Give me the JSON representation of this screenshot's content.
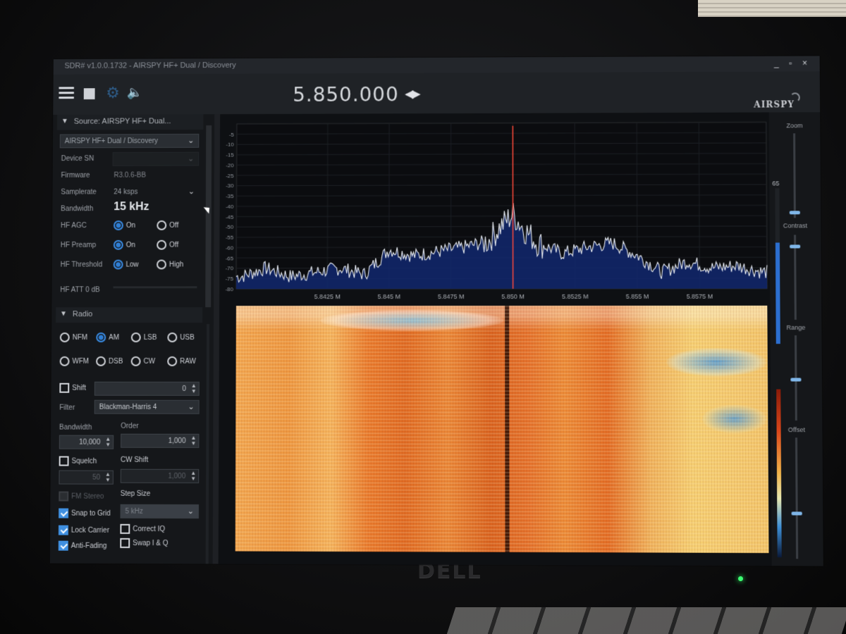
{
  "window": {
    "title": "SDR# v1.0.0.1732 - AIRSPY HF+ Dual / Discovery",
    "controls": [
      "_",
      "▫",
      "×"
    ]
  },
  "toolbar": {
    "frequency": "5.850.000",
    "frequency_arrows": "◀▶",
    "logo": "AIRSPY",
    "icons": [
      "menu-icon",
      "stop-icon",
      "gear-icon",
      "speaker-icon"
    ]
  },
  "source": {
    "header": "Source: AIRSPY HF+ Dual...",
    "device": "AIRSPY HF+ Dual / Discovery",
    "device_sn_label": "Device SN",
    "firmware_label": "Firmware",
    "firmware_value": "R3.0.6-BB",
    "samplerate_label": "Samplerate",
    "samplerate_value": "24 ksps",
    "bandwidth_label": "Bandwidth",
    "bandwidth_value": "15 kHz",
    "hf_agc_label": "HF AGC",
    "hf_preamp_label": "HF Preamp",
    "hf_threshold_label": "HF Threshold",
    "on": "On",
    "off": "Off",
    "low": "Low",
    "high": "High",
    "hf_att": "HF ATT 0 dB"
  },
  "radio": {
    "header": "Radio",
    "modes_row1": [
      "NFM",
      "AM",
      "LSB",
      "USB"
    ],
    "modes_row2": [
      "WFM",
      "DSB",
      "CW",
      "RAW"
    ],
    "selected_mode": "AM",
    "shift_label": "Shift",
    "shift_value": "0",
    "filter_label": "Filter",
    "filter_value": "Blackman-Harris 4",
    "bandwidth_label": "Bandwidth",
    "bandwidth_value": "10,000",
    "order_label": "Order",
    "order_value": "1,000",
    "squelch_label": "Squelch",
    "squelch_value": "50",
    "cw_shift_label": "CW Shift",
    "cw_shift_value": "1,000",
    "fm_stereo_label": "FM Stereo",
    "step_size_label": "Step Size",
    "step_size_value": "5 kHz",
    "snap_label": "Snap to Grid",
    "lock_carrier_label": "Lock Carrier",
    "anti_fading_label": "Anti-Fading",
    "correct_iq_label": "Correct IQ",
    "swap_iq_label": "Swap I & Q"
  },
  "right_panel": {
    "zoom_label": "Zoom",
    "contrast_label": "Contrast",
    "range_label": "Range",
    "offset_label": "Offset",
    "level_value": "65"
  },
  "chart_data": {
    "type": "line",
    "title": "",
    "xlabel": "",
    "ylabel": "",
    "x_ticks": [
      "5.8425 M",
      "5.845 M",
      "5.8475 M",
      "5.850 M",
      "5.8525 M",
      "5.855 M",
      "5.8575 M"
    ],
    "y_ticks": [
      "-5",
      "-10",
      "-15",
      "-20",
      "-25",
      "-30",
      "-35",
      "-40",
      "-45",
      "-50",
      "-55",
      "-60",
      "-65",
      "-70",
      "-75",
      "-80"
    ],
    "xlim": [
      5.8388,
      5.8602
    ],
    "ylim": [
      -80,
      0
    ],
    "center_marker": 5.85,
    "series": [
      {
        "x": [
          5.839,
          5.84,
          5.841,
          5.842,
          5.843,
          5.844,
          5.845,
          5.846,
          5.847,
          5.848,
          5.849,
          5.8495,
          5.85,
          5.8505,
          5.851,
          5.852,
          5.853,
          5.854,
          5.855,
          5.856,
          5.857,
          5.858,
          5.859,
          5.86
        ],
        "y": [
          -74,
          -70,
          -74,
          -72,
          -70,
          -73,
          -61,
          -64,
          -62,
          -60,
          -57,
          -50,
          -44,
          -52,
          -58,
          -63,
          -60,
          -58,
          -64,
          -72,
          -67,
          -70,
          -69,
          -72
        ]
      }
    ]
  }
}
